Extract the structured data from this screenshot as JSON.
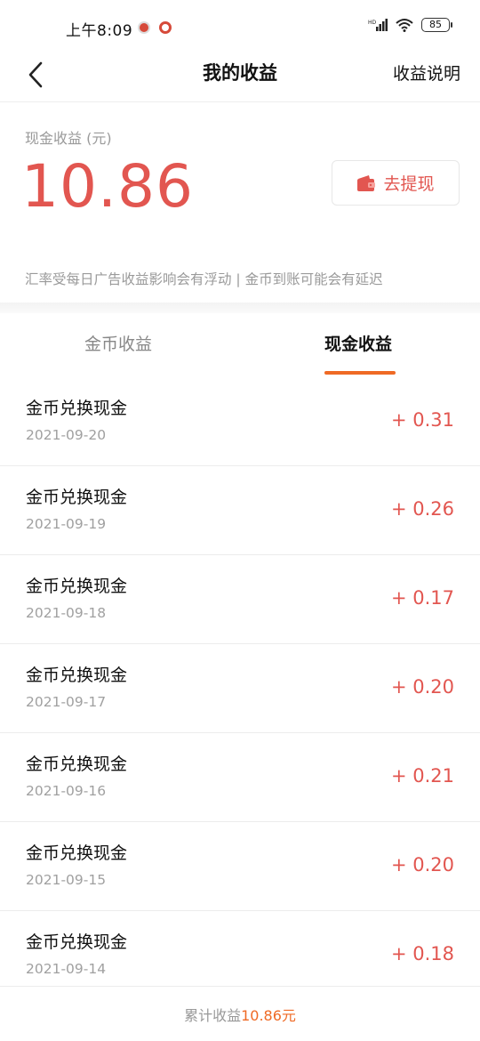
{
  "status_bar": {
    "time": "上午8:09",
    "battery": "85",
    "network_label": "HD"
  },
  "nav": {
    "title": "我的收益",
    "action": "收益说明"
  },
  "summary": {
    "label": "现金收益 (元)",
    "amount": "10.86",
    "withdraw_label": "去提现",
    "notice": "汇率受每日广告收益影响会有浮动 | 金币到账可能会有延迟"
  },
  "tabs": [
    {
      "label": "金币收益",
      "active": false
    },
    {
      "label": "现金收益",
      "active": true
    }
  ],
  "records": [
    {
      "title": "金币兑换现金",
      "date": "2021-09-20",
      "amount": "+ 0.31"
    },
    {
      "title": "金币兑换现金",
      "date": "2021-09-19",
      "amount": "+ 0.26"
    },
    {
      "title": "金币兑换现金",
      "date": "2021-09-18",
      "amount": "+ 0.17"
    },
    {
      "title": "金币兑换现金",
      "date": "2021-09-17",
      "amount": "+ 0.20"
    },
    {
      "title": "金币兑换现金",
      "date": "2021-09-16",
      "amount": "+ 0.21"
    },
    {
      "title": "金币兑换现金",
      "date": "2021-09-15",
      "amount": "+ 0.20"
    },
    {
      "title": "金币兑换现金",
      "date": "2021-09-14",
      "amount": "+ 0.18"
    }
  ],
  "footer": {
    "label": "累计收益",
    "value": "10.86元"
  },
  "colors": {
    "accent_red": "#e25650",
    "accent_orange": "#ef6a25"
  }
}
